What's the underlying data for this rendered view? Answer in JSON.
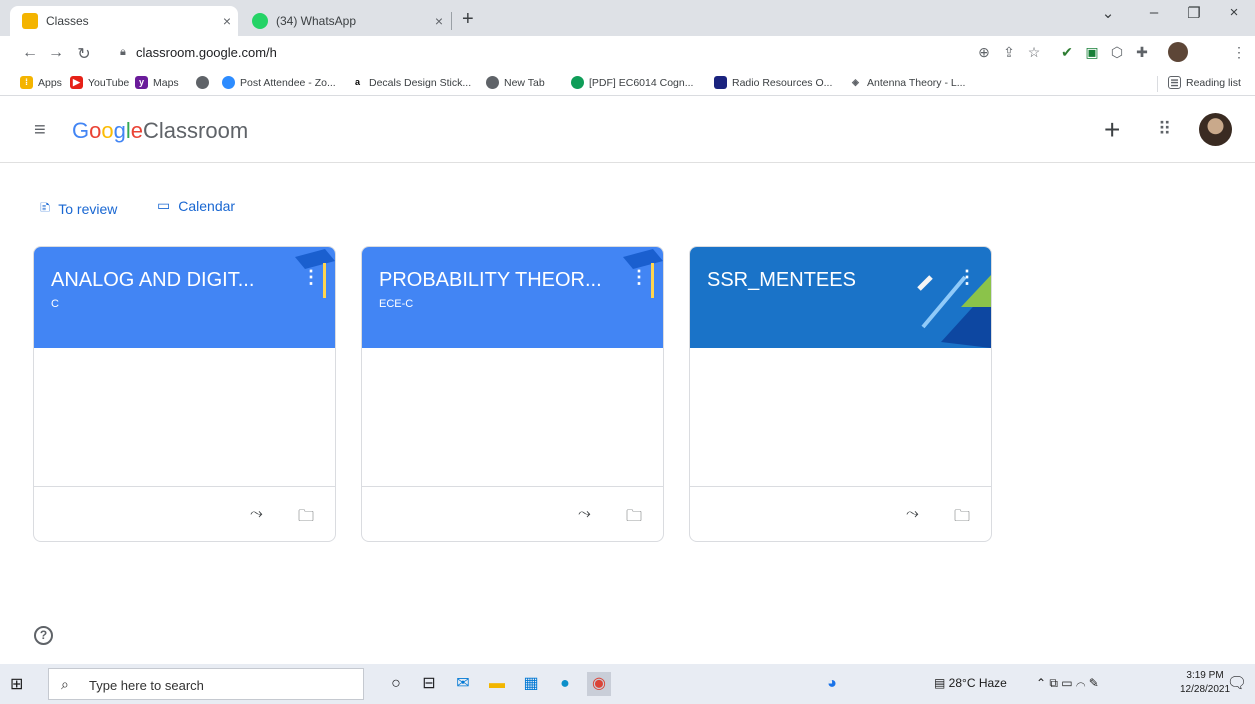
{
  "browser": {
    "tabs": [
      {
        "title": "Classes",
        "close": "×"
      },
      {
        "title": "(34) WhatsApp",
        "close": "×"
      }
    ],
    "new_tab": "+",
    "window_controls": {
      "minimize": "–",
      "restore": "❐",
      "close": "×"
    },
    "url": "classroom.google.com/h",
    "bookmarks": [
      {
        "label": "Apps",
        "icon": "apps-icon"
      },
      {
        "label": "YouTube",
        "icon": "youtube-icon"
      },
      {
        "label": "Maps",
        "icon": "maps-icon"
      },
      {
        "label": "",
        "icon": "globe-icon"
      },
      {
        "label": "Post Attendee - Zo...",
        "icon": "zoom-icon"
      },
      {
        "label": "Decals Design Stick...",
        "icon": "amazon-icon"
      },
      {
        "label": "New Tab",
        "icon": "globe-icon"
      },
      {
        "label": "[PDF] EC6014 Cogn...",
        "icon": "pdf-icon"
      },
      {
        "label": "Radio Resources O...",
        "icon": "radio-icon"
      },
      {
        "label": "Antenna Theory - L...",
        "icon": "antenna-icon"
      }
    ],
    "reading_list": "Reading list"
  },
  "app": {
    "logo_google": "Google",
    "logo_product": "Classroom",
    "plus": "+",
    "links": {
      "to_review": "To review",
      "calendar": "Calendar"
    }
  },
  "classes": [
    {
      "title": "ANALOG AND DIGIT...",
      "section": "C",
      "color": "#4285f4"
    },
    {
      "title": "PROBABILITY THEOR...",
      "section": "ECE-C",
      "color": "#4285f4"
    },
    {
      "title": "SSR_MENTEES",
      "section": "",
      "color": "#1a73c8"
    }
  ],
  "taskbar": {
    "search_placeholder": "Type here to search",
    "weather": "28°C Haze",
    "time": "3:19 PM",
    "date": "12/28/2021"
  }
}
